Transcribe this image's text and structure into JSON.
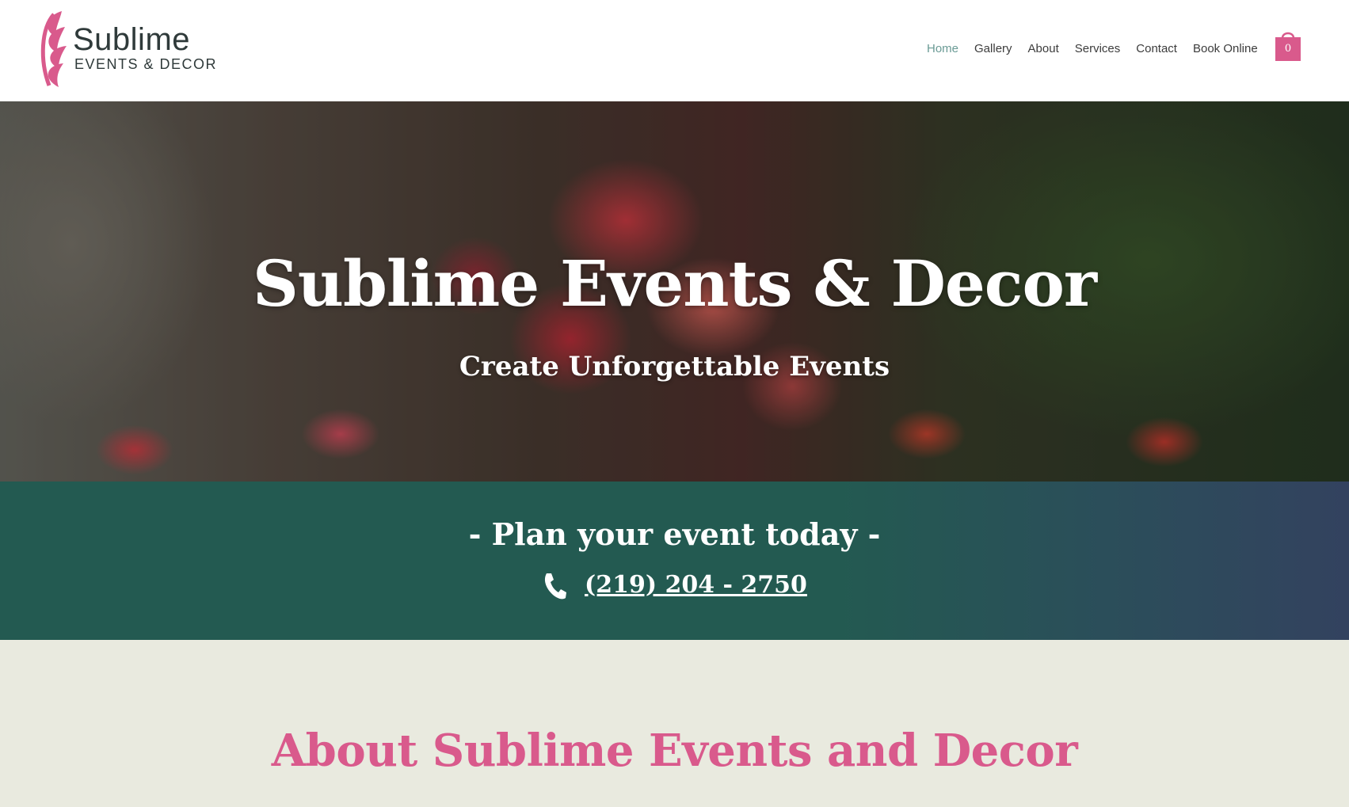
{
  "brand": {
    "name": "Sublime",
    "tagline": "EVENTS & DECOR",
    "logo_icon": "petal-logo-icon",
    "accent_color": "#d95a8c"
  },
  "nav": {
    "items": [
      {
        "label": "Home",
        "active": true
      },
      {
        "label": "Gallery",
        "active": false
      },
      {
        "label": "About",
        "active": false
      },
      {
        "label": "Services",
        "active": false
      },
      {
        "label": "Contact",
        "active": false
      },
      {
        "label": "Book Online",
        "active": false
      }
    ],
    "cart_count": "0",
    "cart_icon": "shopping-bag-icon"
  },
  "hero": {
    "title": "Sublime Events & Decor",
    "subtitle": "Create Unforgettable Events"
  },
  "band": {
    "title": "- Plan your event today -",
    "phone": "(219) 204 - 2750",
    "phone_icon": "phone-icon",
    "color": "#235a51"
  },
  "about": {
    "title": "About Sublime Events and Decor"
  }
}
